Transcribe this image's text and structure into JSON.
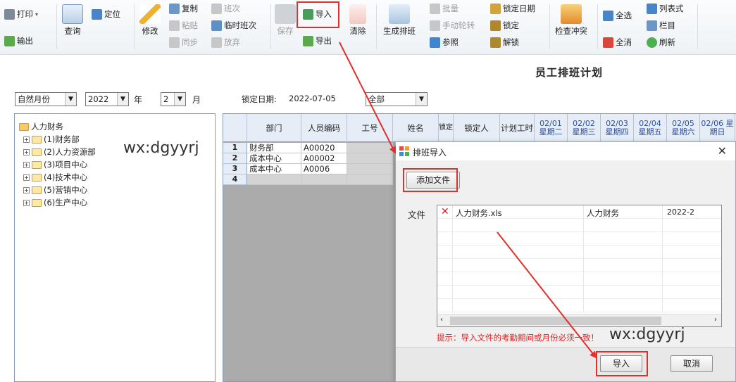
{
  "toolbar": {
    "print": "打印",
    "export_out": "输出",
    "query": "查询",
    "locate": "定位",
    "modify": "修改",
    "copy": "复制",
    "paste": "粘贴",
    "sync": "同步",
    "shift": "班次",
    "temp_shift": "临时班次",
    "discard": "放弃",
    "save": "保存",
    "import": "导入",
    "export": "导出",
    "clear": "清除",
    "generate": "生成排班",
    "batch": "批量",
    "manual_rotate": "手动轮转",
    "reference": "参照",
    "lock_date": "锁定日期",
    "lock": "锁定",
    "unlock": "解锁",
    "check_conflict": "检查冲突",
    "select_all": "全选",
    "deselect_all": "全消",
    "list_view": "列表式",
    "columns": "栏目",
    "refresh": "刷新"
  },
  "page_title": "员工排班计划",
  "filters": {
    "period_type": "自然月份",
    "year": "2022",
    "year_unit": "年",
    "month": "2",
    "month_unit": "月",
    "lock_date_label": "锁定日期:",
    "lock_date_value": "2022-07-05",
    "scope": "全部"
  },
  "tree": {
    "root": "人力财务",
    "children": [
      "(1)财务部",
      "(2)人力资源部",
      "(3)项目中心",
      "(4)技术中心",
      "(5)营销中心",
      "(6)生产中心"
    ]
  },
  "watermark": "wx:dgyyrj",
  "grid": {
    "columns": [
      "部门",
      "人员编码",
      "工号",
      "姓名",
      "锁定",
      "锁定人",
      "计划工时",
      "02/01 星期二",
      "02/02 星期三",
      "02/03 星期四",
      "02/04 星期五",
      "02/05 星期六",
      "02/06 星期日"
    ],
    "rows": [
      {
        "num": "1",
        "dept": "财务部",
        "code": "A00020"
      },
      {
        "num": "2",
        "dept": "成本中心",
        "code": "A00002"
      },
      {
        "num": "3",
        "dept": "成本中心",
        "code": "A0006"
      },
      {
        "num": "4",
        "dept": "",
        "code": ""
      }
    ]
  },
  "dialog": {
    "title": "排班导入",
    "add_file": "添加文件",
    "file_label": "文件",
    "files": [
      {
        "name": "人力财务.xls",
        "company": "人力财务",
        "period": "2022-2"
      }
    ],
    "tip": "提示：导入文件的考勤期间或月份必须一致！",
    "import_btn": "导入",
    "cancel_btn": "取消"
  }
}
